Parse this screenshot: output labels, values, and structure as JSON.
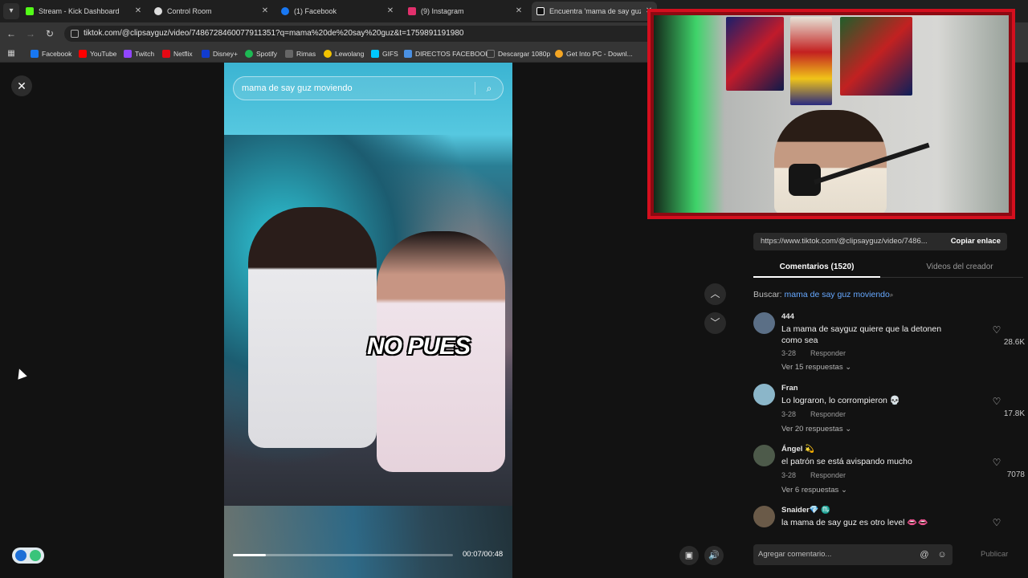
{
  "tabs": [
    {
      "title": "Stream - Kick Dashboard",
      "color": "#53fc18"
    },
    {
      "title": "Control Room",
      "color": "#dddddd"
    },
    {
      "title": "(1) Facebook",
      "color": "#1877f2"
    },
    {
      "title": "(9) Instagram",
      "color": "#e1306c"
    },
    {
      "title": "Encuentra 'mama de say guz",
      "color": "#ffffff"
    }
  ],
  "address": {
    "url": "tiktok.com/@clipsayguz/video/7486728460077911351?q=mama%20de%20say%20guz&t=1759891191980"
  },
  "bookmarks": [
    {
      "label": "Facebook",
      "color": "#1877f2"
    },
    {
      "label": "YouTube",
      "color": "#ff0000"
    },
    {
      "label": "Twitch",
      "color": "#9146ff"
    },
    {
      "label": "Netflix",
      "color": "#e50914"
    },
    {
      "label": "Disney+",
      "color": "#113ccf"
    },
    {
      "label": "Spotify",
      "color": "#1db954"
    },
    {
      "label": "Rimas",
      "color": "#666666"
    },
    {
      "label": "Lewolang",
      "color": "#f2c200"
    },
    {
      "label": "GIFS",
      "color": "#00c8ff"
    },
    {
      "label": "DIRECTOS FACEBOOK",
      "color": "#4a90e2"
    },
    {
      "label": "Descargar 1080p",
      "color": "#333333"
    },
    {
      "label": "Get Into PC - Downl...",
      "color": "#f5a623"
    }
  ],
  "video": {
    "search_text": "mama de say guz moviendo",
    "caption": "NO PUES",
    "time": "00:07/00:48",
    "progress": 0.15
  },
  "panel": {
    "link": "https://www.tiktok.com/@clipsayguz/video/7486...",
    "copy_label": "Copiar enlace",
    "tab_comments": "Comentarios (1520)",
    "tab_creator": "Videos del creador",
    "search_label": "Buscar:",
    "search_query": "mama de say guz moviendo",
    "comment_placeholder": "Agregar comentario...",
    "publish_label": "Publicar",
    "comments": [
      {
        "name": "444",
        "text": "La mama de sayguz quiere que la detonen como sea",
        "date": "3-28",
        "reply": "Responder",
        "more": "Ver 15 respuestas",
        "likes": "28.6K"
      },
      {
        "name": "Fran",
        "text": "Lo lograron, lo corrompieron 💀",
        "date": "3-28",
        "reply": "Responder",
        "more": "Ver 20 respuestas",
        "likes": "17.8K"
      },
      {
        "name": "Ángel 💫",
        "text": "el patrón se está avispando mucho",
        "date": "3-28",
        "reply": "Responder",
        "more": "Ver 6 respuestas",
        "likes": "7078"
      },
      {
        "name": "Snaider💎 ♏",
        "text": "la mama de say guz es otro level 👄👄",
        "date": "",
        "reply": "",
        "more": "",
        "likes": ""
      }
    ]
  }
}
